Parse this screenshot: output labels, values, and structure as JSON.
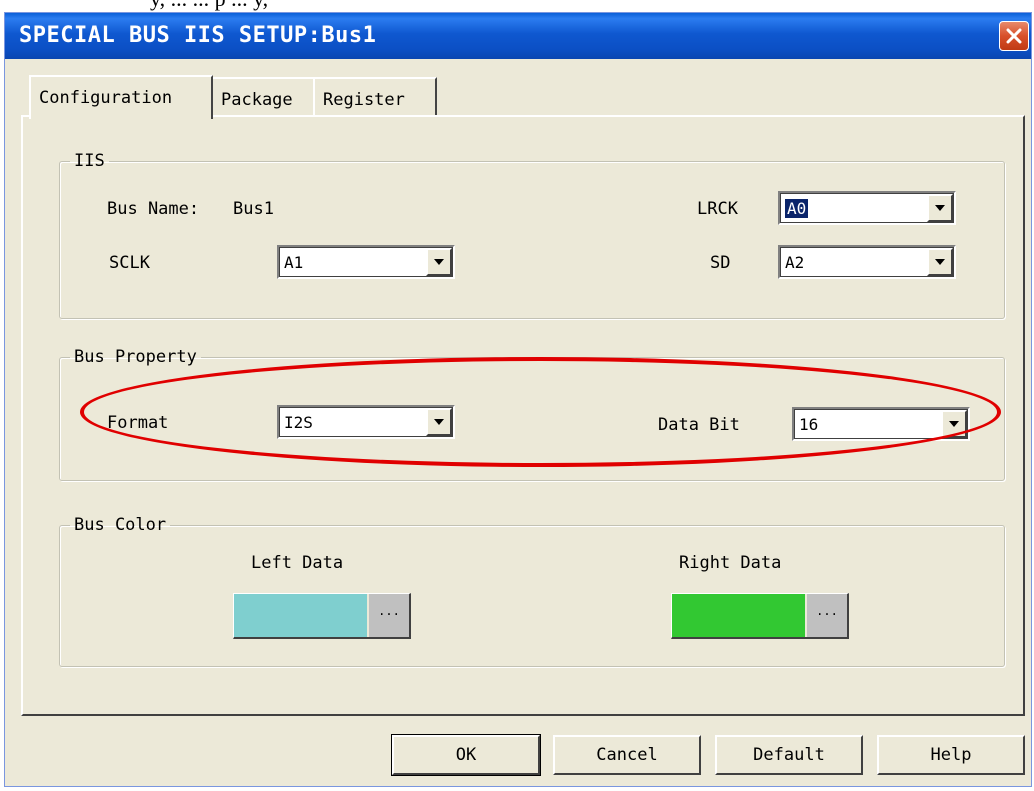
{
  "window": {
    "title": "SPECIAL BUS IIS SETUP:Bus1"
  },
  "top_clip_text": "y, ... ... p ... y,",
  "tabs": [
    {
      "label": "Configuration",
      "active": true
    },
    {
      "label": "Package",
      "active": false
    },
    {
      "label": "Register",
      "active": false
    }
  ],
  "iis": {
    "legend": "IIS",
    "bus_name_label": "Bus Name:",
    "bus_name_value": "Bus1",
    "lrck_label": "LRCK",
    "lrck_value": "A0",
    "sclk_label": "SCLK",
    "sclk_value": "A1",
    "sd_label": "SD",
    "sd_value": "A2"
  },
  "bus_property": {
    "legend": "Bus Property",
    "format_label": "Format",
    "format_value": "I2S",
    "data_bit_label": "Data Bit",
    "data_bit_value": "16"
  },
  "bus_color": {
    "legend": "Bus Color",
    "left_label": "Left Data",
    "left_color": "#7fcfcf",
    "right_label": "Right Data",
    "right_color": "#32c832",
    "browse_glyph": "..."
  },
  "buttons": {
    "ok": "OK",
    "cancel": "Cancel",
    "default": "Default",
    "help": "Help"
  },
  "colors": {
    "titlebar": "#0a4fc4",
    "dialog_bg": "#ece9d8",
    "close_button": "#d8502a",
    "highlight_ellipse": "#e00000",
    "selection": "#0a246a"
  }
}
